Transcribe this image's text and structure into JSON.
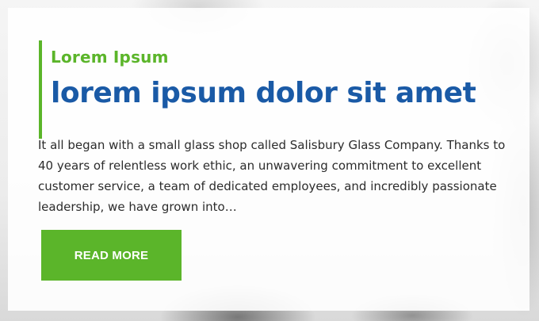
{
  "eyebrow": "Lorem Ipsum",
  "title": "lorem ipsum dolor sit amet",
  "body": "It all began with a small glass shop called Salisbury Glass Company. Thanks to 40 years of relentless work ethic, an unwavering commitment to excellent customer service, a team of dedicated employees, and incredibly passionate leadership, we have grown into…",
  "button": {
    "label": "READ MORE"
  },
  "colors": {
    "accent": "#5bb52a",
    "title": "#1a5aa6",
    "text": "#2c2c2c"
  }
}
